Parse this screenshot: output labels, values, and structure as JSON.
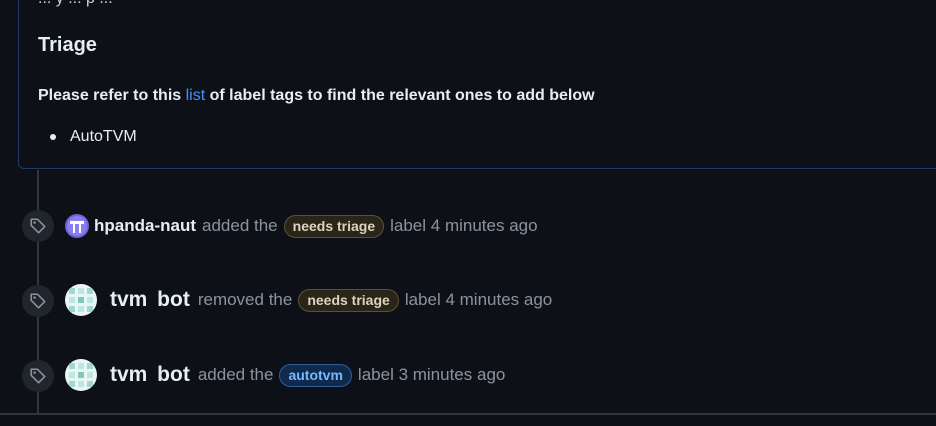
{
  "comment": {
    "cut_text": "... y ... p ...",
    "heading": "Triage",
    "paragraph_before": "Please refer to this ",
    "paragraph_link": "list",
    "paragraph_after": " of label tags to find the relevant ones to add below",
    "bullets": [
      "AutoTVM"
    ]
  },
  "timeline": [
    {
      "icon": "tag-icon",
      "actor": "hpanda-naut",
      "action": "added the",
      "label": "needs triage",
      "suffix": "label 4 minutes ago"
    },
    {
      "icon": "tag-icon",
      "actor": "tvm bot",
      "action": "removed the",
      "label": "needs triage",
      "suffix": "label 4 minutes ago"
    },
    {
      "icon": "tag-icon",
      "actor": "tvm bot",
      "action": "added the",
      "label": "autotvm",
      "suffix": "label 3 minutes ago"
    }
  ],
  "colors": {
    "background": "#0d1117",
    "link": "#4493f8",
    "needs_triage_label": "#d9d4bd",
    "autotvm_label": "#79b8ff"
  }
}
